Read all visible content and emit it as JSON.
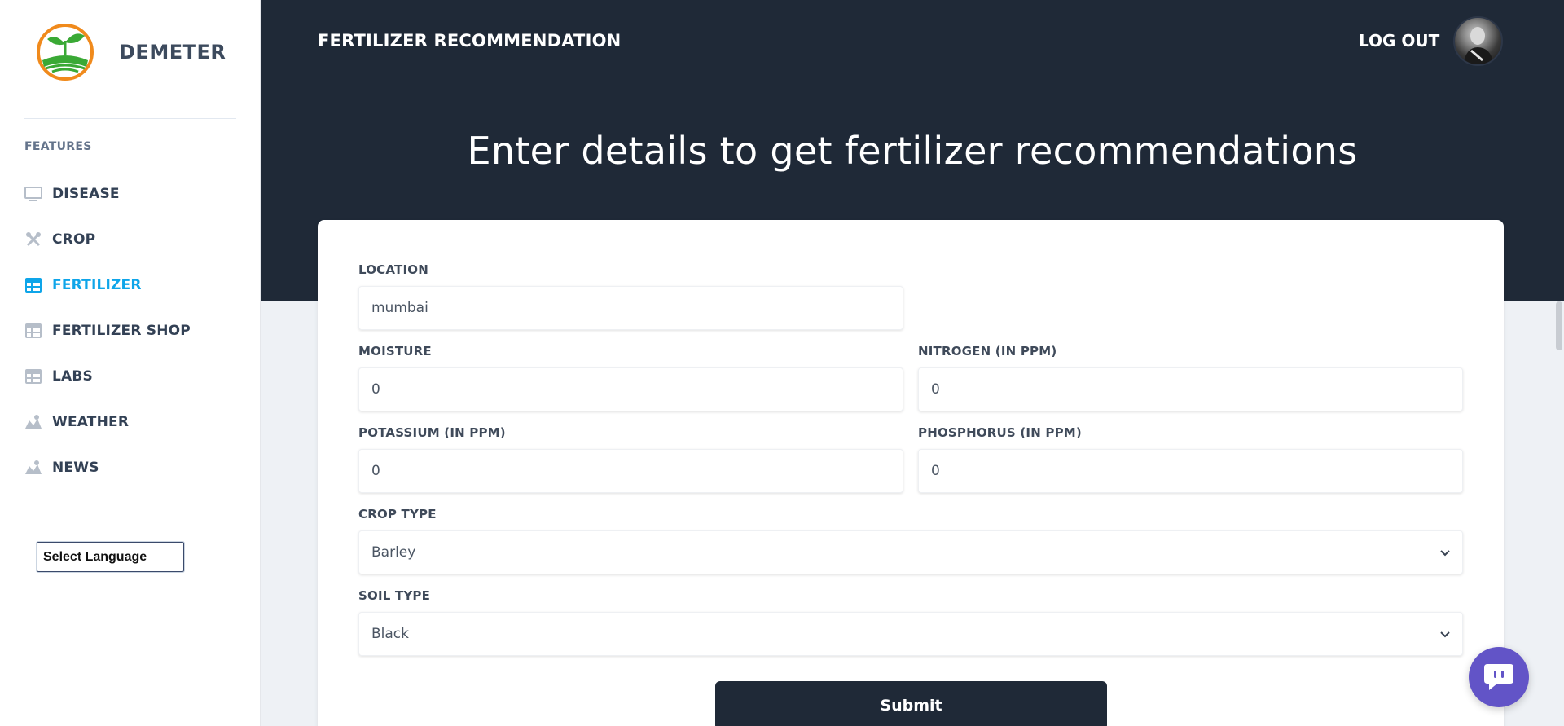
{
  "sidebar": {
    "brand_name": "DEMETER",
    "features_label": "FEATURES",
    "items": [
      {
        "label": "DISEASE",
        "icon": "monitor-icon"
      },
      {
        "label": "CROP",
        "icon": "tools-icon"
      },
      {
        "label": "FERTILIZER",
        "icon": "table-icon",
        "active": true
      },
      {
        "label": "FERTILIZER SHOP",
        "icon": "table-icon"
      },
      {
        "label": "LABS",
        "icon": "table-icon"
      },
      {
        "label": "WEATHER",
        "icon": "map-icon"
      },
      {
        "label": "NEWS",
        "icon": "map-icon"
      }
    ],
    "language_select": "Select Language"
  },
  "header": {
    "title": "FERTILIZER RECOMMENDATION",
    "logout_label": "LOG OUT"
  },
  "hero": {
    "heading": "Enter details to get fertilizer recommendations"
  },
  "form": {
    "location": {
      "label": "LOCATION",
      "value": "mumbai"
    },
    "moisture": {
      "label": "MOISTURE",
      "value": "0"
    },
    "nitrogen": {
      "label": "NITROGEN (IN PPM)",
      "value": "0"
    },
    "potassium": {
      "label": "POTASSIUM (IN PPM)",
      "value": "0"
    },
    "phosphorus": {
      "label": "PHOSPHORUS (IN PPM)",
      "value": "0"
    },
    "crop_type": {
      "label": "CROP TYPE",
      "value": "Barley"
    },
    "soil_type": {
      "label": "SOIL TYPE",
      "value": "Black"
    },
    "submit_label": "Submit"
  },
  "colors": {
    "header_bg": "#1f2937",
    "active_nav": "#0ea5e9",
    "chat_button": "#6254c7",
    "logo_ring": "#f08a1c",
    "logo_leaf": "#3aa935"
  }
}
